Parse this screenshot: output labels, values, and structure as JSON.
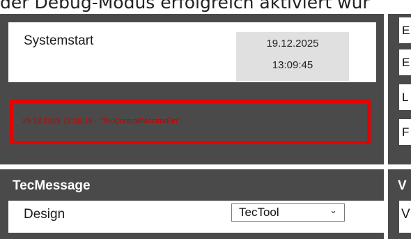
{
  "top_banner": "der Debug-Modus erfolgreich aktiviert wur",
  "system": {
    "label": "Systemstart",
    "date": "19.12.2025",
    "time": "13:09:45"
  },
  "error_log": "29.12.2025 12:05:16 - \"TecControl/MonitorEin\"",
  "right_column_cells": [
    "E",
    "E",
    "L",
    "F"
  ],
  "tecmessage": {
    "title": "TecMessage",
    "design_label": "Design",
    "design_value": "TecTool"
  },
  "right_section": {
    "title": "V",
    "value": "V"
  }
}
